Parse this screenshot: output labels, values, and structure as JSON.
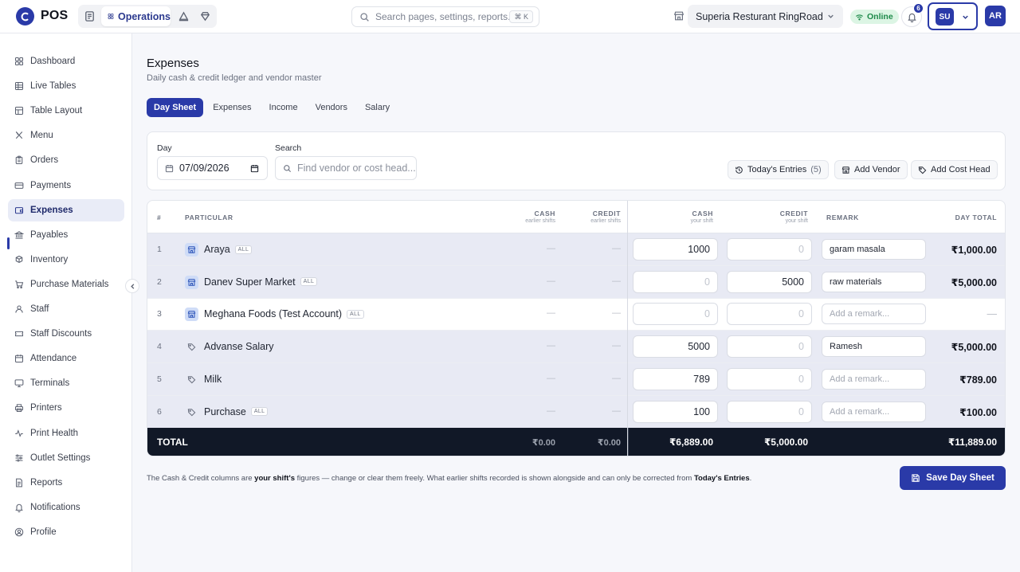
{
  "header": {
    "brand": "POS",
    "mode_active": "Operations",
    "search_placeholder": "Search pages, settings, reports...",
    "search_shortcut": "⌘ K",
    "outlet": "Superia Resturant RingRoad",
    "status": "Online",
    "notification_count": "6",
    "user_initials": "SU",
    "account_initials": "AR"
  },
  "sidebar": {
    "items": [
      {
        "label": "Dashboard",
        "icon": "dashboard-icon"
      },
      {
        "label": "Live Tables",
        "icon": "grid-icon"
      },
      {
        "label": "Table Layout",
        "icon": "layout-icon"
      },
      {
        "label": "Menu",
        "icon": "utensils-icon"
      },
      {
        "label": "Orders",
        "icon": "clipboard-icon"
      },
      {
        "label": "Payments",
        "icon": "card-icon"
      },
      {
        "label": "Expenses",
        "icon": "wallet-icon"
      },
      {
        "label": "Payables",
        "icon": "bank-icon"
      },
      {
        "label": "Inventory",
        "icon": "boxes-icon"
      },
      {
        "label": "Purchase Materials",
        "icon": "cart-icon"
      },
      {
        "label": "Staff",
        "icon": "user-icon"
      },
      {
        "label": "Staff Discounts",
        "icon": "ticket-icon"
      },
      {
        "label": "Attendance",
        "icon": "calendar-icon"
      },
      {
        "label": "Terminals",
        "icon": "monitor-icon"
      },
      {
        "label": "Printers",
        "icon": "printer-icon"
      },
      {
        "label": "Print Health",
        "icon": "pulse-icon"
      },
      {
        "label": "Outlet Settings",
        "icon": "sliders-icon"
      },
      {
        "label": "Reports",
        "icon": "file-icon"
      },
      {
        "label": "Notifications",
        "icon": "bell-icon"
      },
      {
        "label": "Profile",
        "icon": "profile-icon"
      }
    ],
    "active": "Expenses"
  },
  "page": {
    "title": "Expenses",
    "subtitle": "Daily cash & credit ledger and vendor master",
    "tabs": [
      "Day Sheet",
      "Expenses",
      "Income",
      "Vendors",
      "Salary"
    ],
    "active_tab": "Day Sheet"
  },
  "filters": {
    "day_label": "Day",
    "day_value": "07/09/2026",
    "search_label": "Search",
    "search_placeholder": "Find vendor or cost head...",
    "todays_entries_label": "Today's Entries",
    "todays_entries_count": "(5)",
    "add_vendor_label": "Add Vendor",
    "add_cost_head_label": "Add Cost Head"
  },
  "table": {
    "headers": {
      "num": "#",
      "particular": "Particular",
      "cash_earlier": "Cash",
      "cash_earlier_sub": "earlier shifts",
      "credit_earlier": "Credit",
      "credit_earlier_sub": "earlier shifts",
      "cash_shift": "Cash",
      "cash_shift_sub": "your shift",
      "credit_shift": "Credit",
      "credit_shift_sub": "your shift",
      "remark": "Remark",
      "day_total": "Day Total"
    },
    "dash": "—",
    "remark_placeholder": "Add a remark...",
    "all_tag": "ALL",
    "rows": [
      {
        "num": "1",
        "name": "Araya",
        "type": "vendor",
        "all": true,
        "cash": "1000",
        "credit": "0",
        "remark": "garam masala",
        "day_total": "₹1,000.00"
      },
      {
        "num": "2",
        "name": "Danev Super Market",
        "type": "vendor",
        "all": true,
        "cash": "0",
        "credit": "5000",
        "remark": "raw materials",
        "day_total": "₹5,000.00"
      },
      {
        "num": "3",
        "name": "Meghana Foods (Test Account)",
        "type": "vendor",
        "all": true,
        "cash": "0",
        "credit": "0",
        "remark": "",
        "day_total": "—"
      },
      {
        "num": "4",
        "name": "Advanse Salary",
        "type": "cost",
        "all": false,
        "cash": "5000",
        "credit": "0",
        "remark": "Ramesh",
        "day_total": "₹5,000.00"
      },
      {
        "num": "5",
        "name": "Milk",
        "type": "cost",
        "all": false,
        "cash": "789",
        "credit": "0",
        "remark": "",
        "day_total": "₹789.00"
      },
      {
        "num": "6",
        "name": "Purchase",
        "type": "cost",
        "all": true,
        "cash": "100",
        "credit": "0",
        "remark": "",
        "day_total": "₹100.00"
      }
    ],
    "total": {
      "label": "TOTAL",
      "cash_earlier": "₹0.00",
      "credit_earlier": "₹0.00",
      "cash_shift": "₹6,889.00",
      "credit_shift": "₹5,000.00",
      "day_total": "₹11,889.00"
    }
  },
  "footnote": {
    "part1": "The Cash & Credit columns are ",
    "bold1": "your shift's",
    "part2": " figures — change or clear them freely. What earlier shifts recorded is shown alongside and can only be corrected from ",
    "bold2": "Today's Entries",
    "part3": "."
  },
  "save_label": "Save Day Sheet",
  "colors": {
    "accent": "#2a3aa8",
    "total_bg": "#111827",
    "online_bg": "#dcf5e4"
  }
}
